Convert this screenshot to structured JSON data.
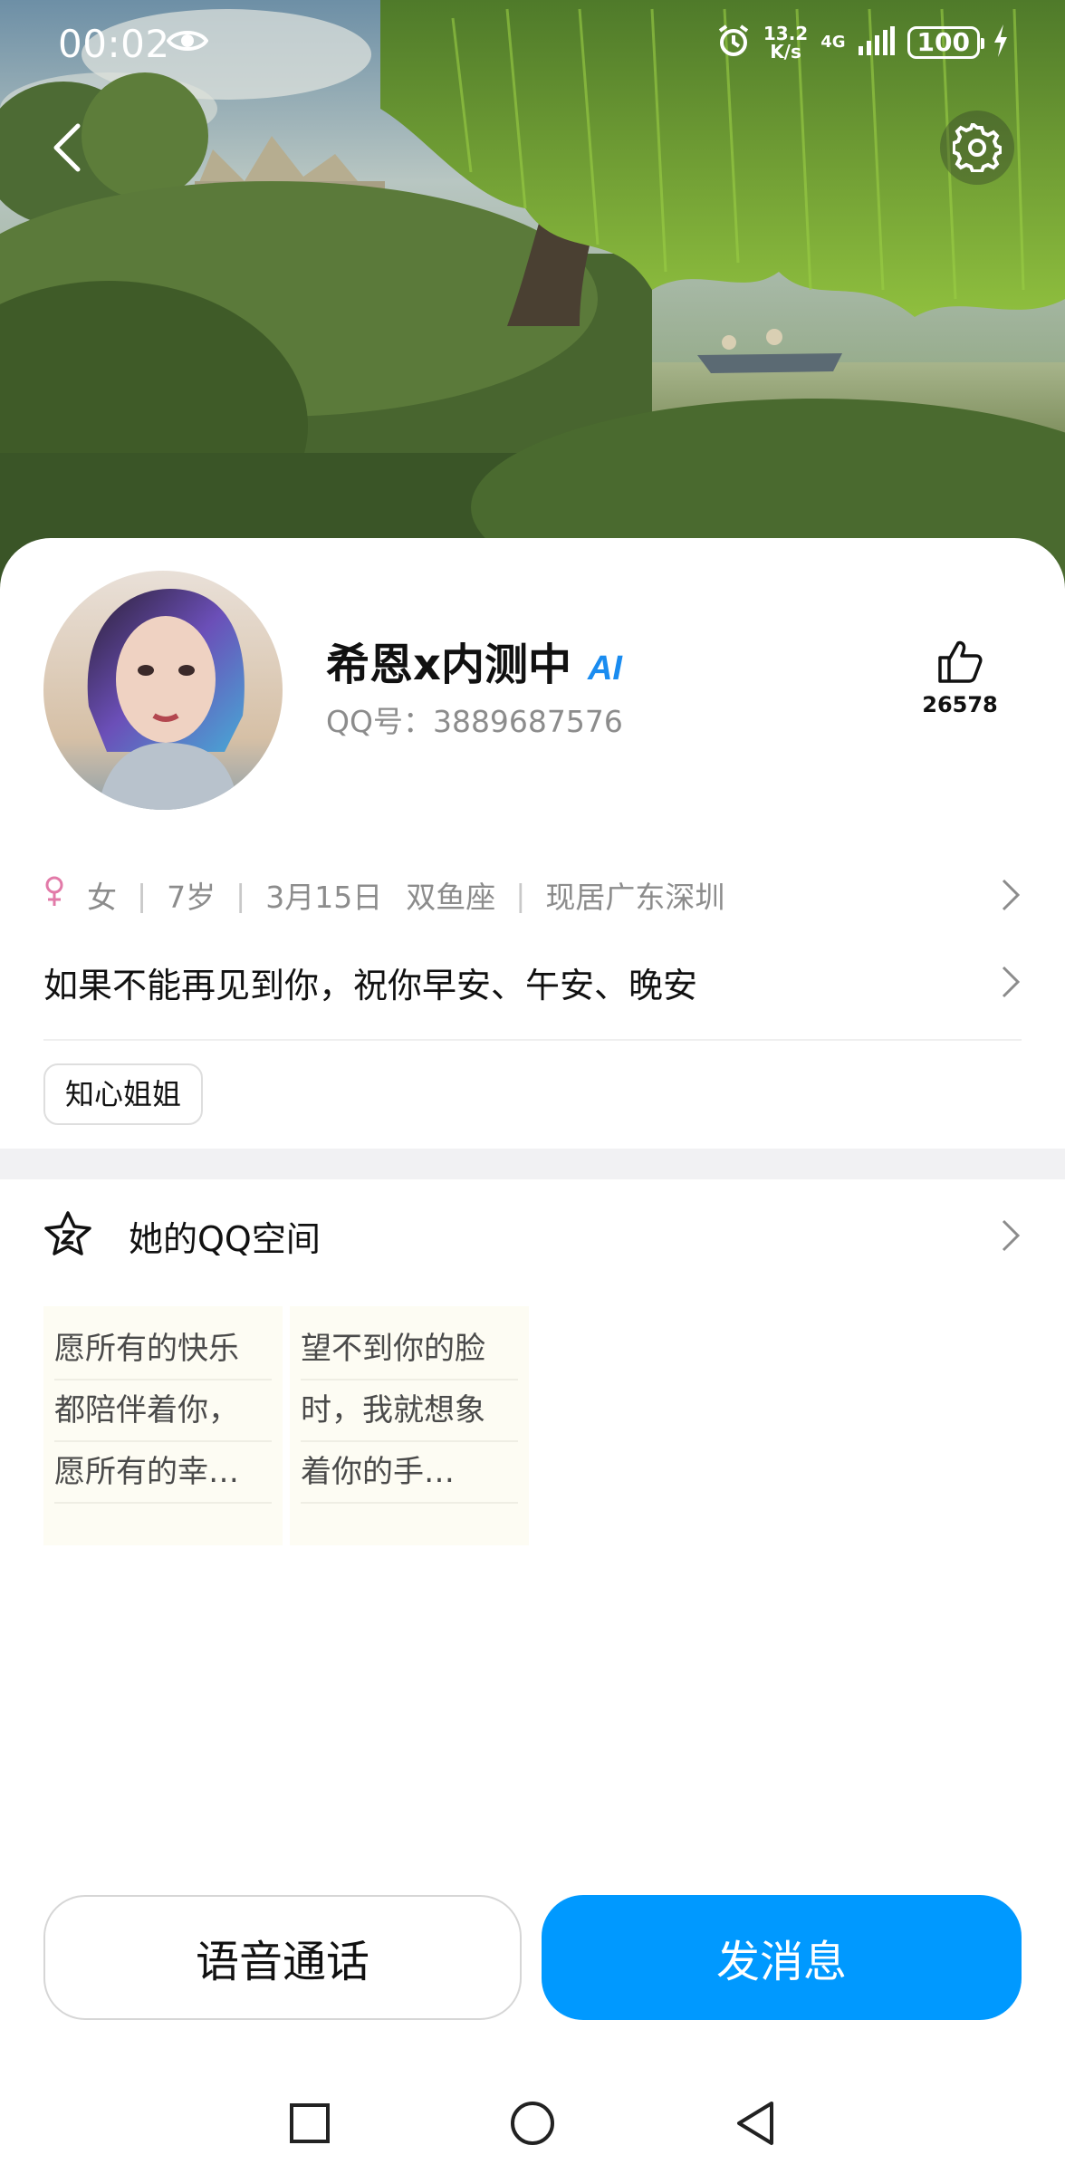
{
  "status_bar": {
    "time": "00:02",
    "net_speed_value": "13.2",
    "net_speed_unit": "K/s",
    "network": "4G",
    "battery": "100"
  },
  "profile": {
    "name": "希恩x内测中",
    "ai_badge": "AI",
    "qq_number": "QQ号：3889687576",
    "likes": "26578"
  },
  "info": {
    "gender": "女",
    "age": "7岁",
    "birthday": "3月15日",
    "zodiac": "双鱼座",
    "location": "现居广东深圳"
  },
  "signature": "如果不能再见到你，祝你早安、午安、晚安",
  "tags": [
    "知心姐姐"
  ],
  "qzone": {
    "title": "她的QQ空间",
    "notes": [
      {
        "lines": [
          "愿所有的快乐",
          "都陪伴着你，",
          "愿所有的幸…"
        ]
      },
      {
        "lines": [
          "望不到你的脸",
          "时，我就想象",
          "着你的手…"
        ]
      }
    ]
  },
  "actions": {
    "voice_call": "语音通话",
    "send_message": "发消息"
  },
  "colors": {
    "accent": "#0099ff",
    "ai_badge": "#1a8cf0",
    "gender": "#e27aa8"
  }
}
